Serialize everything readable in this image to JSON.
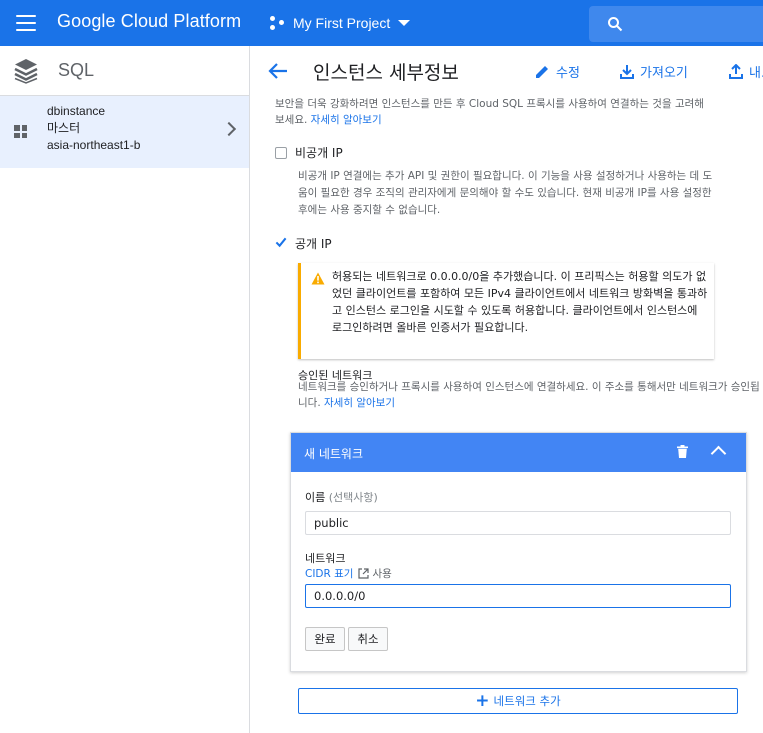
{
  "topbar": {
    "brand": "Google Cloud Platform",
    "project": "My First Project",
    "icons": [
      "menu-icon",
      "project-icon",
      "dropdown-caret-icon",
      "search-icon"
    ],
    "color": "#1a73e8"
  },
  "sidebar": {
    "title": "SQL",
    "instance": {
      "name": "dbinstance",
      "role": "마스터",
      "region": "asia-northeast1-b"
    }
  },
  "header": {
    "title": "인스턴스 세부정보",
    "edit": "수정",
    "import": "가져오기",
    "export": "내..."
  },
  "content": {
    "top_info": "보안을 더욱 강화하려면 인스턴스를 만든 후 Cloud SQL 프록시를 사용하여 연결하는 것을 고려해 보세요.",
    "top_info_link": "자세히 알아보기",
    "private_ip_label": "비공개 IP",
    "private_ip_checked": false,
    "private_ip_desc": "비공개 IP 연결에는 추가 API 및 권한이 필요합니다. 이 기능을 사용 설정하거나 사용하는 데 도움이 필요한 경우 조직의 관리자에게 문의해야 할 수도 있습니다. 현재 비공개 IP를 사용 설정한 후에는 사용 중지할 수 없습니다.",
    "public_ip_label": "공개 IP",
    "public_ip_checked": true,
    "warning": "허용되는 네트워크로 0.0.0.0/0을 추가했습니다. 이 프리픽스는 허용할 의도가 없었던 클라이언트를 포함하여 모든 IPv4 클라이언트에서 네트워크 방화벽을 통과하고 인스턴스 로그인을 시도할 수 있도록 허용합니다. 클라이언트에서 인스턴스에 로그인하려면 올바른 인증서가 필요합니다.",
    "auth_title": "승인된 네트워크",
    "auth_desc": "네트워크를 승인하거나 프록시를 사용하여 인스턴스에 연결하세요. 이 주소를 통해서만 네트워크가 승인됩니다.",
    "auth_link": "자세히 알아보기"
  },
  "card": {
    "title": "새 네트워크",
    "name_label": "이름",
    "name_optional": "(선택사항)",
    "name_value": "public",
    "network_label": "네트워크",
    "cidr_link": "CIDR 표기",
    "cidr_suffix": "사용",
    "network_value": "0.0.0.0/0",
    "done": "완료",
    "cancel": "취소"
  },
  "add_network": "네트워크 추가"
}
